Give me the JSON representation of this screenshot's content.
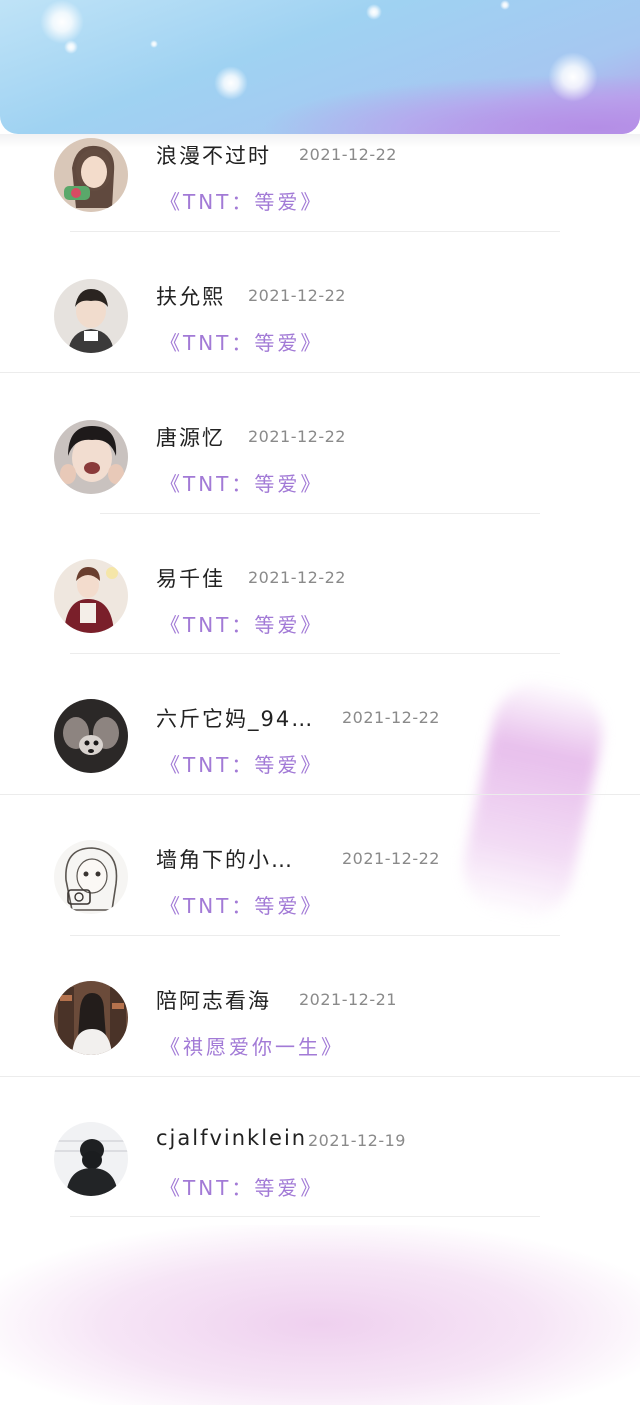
{
  "colors": {
    "song_title": "#a27ad6",
    "name_text": "#222222",
    "date_text": "#8a8a8a",
    "banner_start": "#bfe3f7",
    "banner_end": "#b89be8"
  },
  "items": [
    {
      "name": "浪漫不过时",
      "date": "2021-12-22",
      "song": "《TNT：等爱》",
      "avatar_icon": "user-avatar-photo"
    },
    {
      "name": "扶允熙",
      "date": "2021-12-22",
      "song": "《TNT：等爱》",
      "avatar_icon": "user-avatar-photo"
    },
    {
      "name": "唐源忆",
      "date": "2021-12-22",
      "song": "《TNT：等爱》",
      "avatar_icon": "user-avatar-photo"
    },
    {
      "name": "易千佳",
      "date": "2021-12-22",
      "song": "《TNT：等爱》",
      "avatar_icon": "user-avatar-photo"
    },
    {
      "name": "六斤它妈_94…",
      "date": "2021-12-22",
      "song": "《TNT：等爱》",
      "avatar_icon": "user-avatar-photo"
    },
    {
      "name": "墙角下的小…",
      "date": "2021-12-22",
      "song": "《TNT：等爱》",
      "avatar_icon": "user-avatar-photo"
    },
    {
      "name": "陪阿志看海",
      "date": "2021-12-21",
      "song": "《祺愿爱你一生》",
      "avatar_icon": "user-avatar-photo"
    },
    {
      "name": "cjalfvinklein",
      "date": "2021-12-19",
      "song": "《TNT：等爱》",
      "avatar_icon": "user-avatar-photo"
    }
  ]
}
